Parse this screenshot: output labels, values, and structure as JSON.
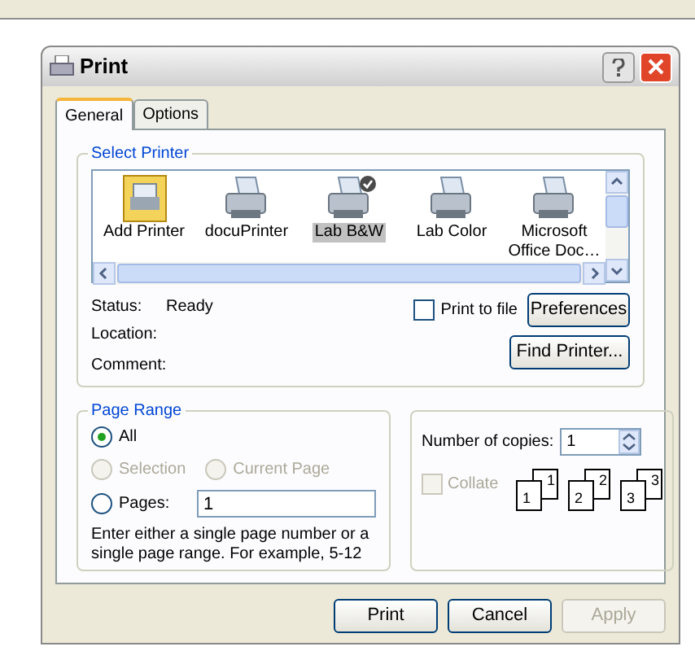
{
  "window": {
    "title": "Print"
  },
  "tabs": [
    {
      "label": "General",
      "selected": true
    },
    {
      "label": "Options",
      "selected": false
    }
  ],
  "select_printer": {
    "title": "Select Printer",
    "printers": [
      {
        "name": "Add Printer",
        "kind": "add",
        "selected": false,
        "default": false
      },
      {
        "name": "docuPrinter",
        "kind": "printer",
        "selected": false,
        "default": false
      },
      {
        "name": "Lab B&W",
        "kind": "printer",
        "selected": true,
        "default": true
      },
      {
        "name": "Lab Color",
        "kind": "printer",
        "selected": false,
        "default": false
      },
      {
        "name": "Microsoft Office Doc…",
        "kind": "printer",
        "selected": false,
        "default": false
      }
    ],
    "status_label": "Status:",
    "status": "Ready",
    "location_label": "Location:",
    "comment_label": "Comment:",
    "print_to_file": {
      "label": "Print to file",
      "checked": false
    },
    "buttons": [
      "Preferences",
      "Find Printer..."
    ]
  },
  "page_range": {
    "title": "Page Range",
    "options": [
      {
        "label": "All",
        "selected": true,
        "disabled": false
      },
      {
        "label": "Selection",
        "selected": false,
        "disabled": true
      },
      {
        "label": "Current Page",
        "selected": false,
        "disabled": true
      },
      {
        "label": "Pages:",
        "selected": false,
        "disabled": false
      }
    ],
    "pages_value": "1",
    "hint": "Enter either a single page number or a single page range.  For example, 5-12"
  },
  "copies": {
    "label": "Number of copies:",
    "value": "1",
    "collate": {
      "label": "Collate",
      "checked": false,
      "disabled": true
    },
    "sets": [
      {
        "back": "1",
        "front": "1"
      },
      {
        "back": "2",
        "front": "2"
      },
      {
        "back": "3",
        "front": "3"
      }
    ]
  },
  "buttons": [
    {
      "label": "Print",
      "disabled": false
    },
    {
      "label": "Cancel",
      "disabled": false
    },
    {
      "label": "Apply",
      "disabled": true
    }
  ]
}
